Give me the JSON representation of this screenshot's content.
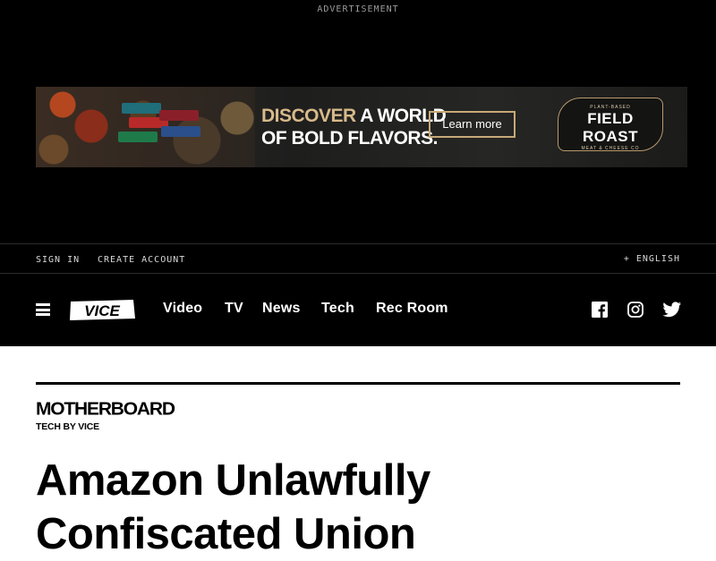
{
  "ad": {
    "label": "ADVERTISEMENT",
    "headline_accent": "DISCOVER",
    "headline_rest_1": "A WORLD",
    "headline_line2": "OF BOLD FLAVORS.",
    "cta": "Learn more",
    "logo_top": "PLANT-BASED",
    "logo_main": "FIELD ROAST",
    "logo_bottom": "MEAT & CHEESE CO"
  },
  "utility": {
    "sign_in": "SIGN IN",
    "create_account": "CREATE ACCOUNT",
    "language": "+ ENGLISH"
  },
  "nav": {
    "menu_icon": "hamburger-icon",
    "logo": "VICE",
    "items": [
      {
        "label": "Video"
      },
      {
        "label": "TV"
      },
      {
        "label": "News"
      },
      {
        "label": "Tech"
      },
      {
        "label": "Rec Room"
      }
    ],
    "social": [
      "facebook-icon",
      "instagram-icon",
      "twitter-icon"
    ]
  },
  "article": {
    "brand": "MOTHERBOARD",
    "brand_tagline": "TECH BY VICE",
    "headline": "Amazon Unlawfully Confiscated Union"
  },
  "colors": {
    "background_dark": "#000000",
    "page_background": "#ffffff",
    "ad_accent": "#d7b98a",
    "text_light": "#ffffff"
  }
}
